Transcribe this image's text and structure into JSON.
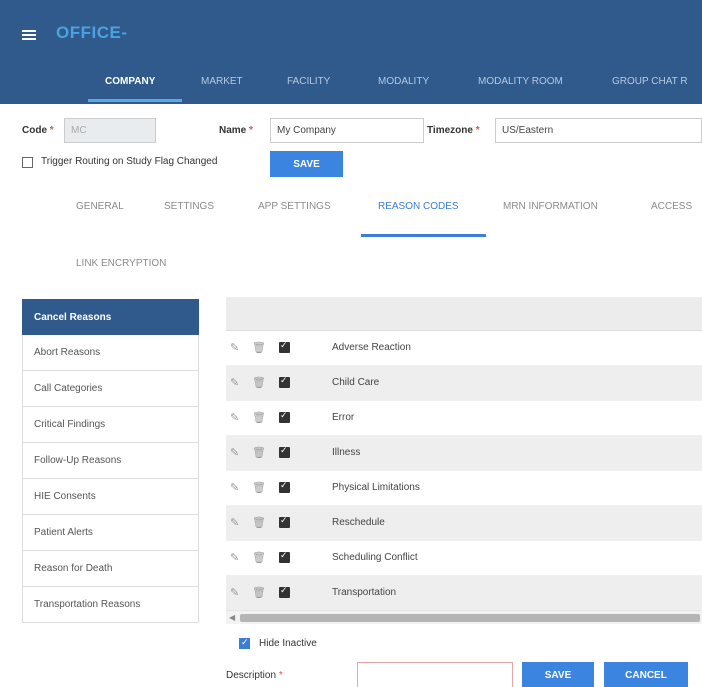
{
  "app": {
    "title": "OFFICE-"
  },
  "nav": {
    "tabs": [
      "COMPANY",
      "MARKET",
      "FACILITY",
      "MODALITY",
      "MODALITY ROOM",
      "GROUP CHAT R"
    ]
  },
  "form": {
    "code_label": "Code",
    "code_value": "MC",
    "name_label": "Name",
    "name_value": "My Company",
    "timezone_label": "Timezone",
    "timezone_value": "US/Eastern",
    "required_mark": "*",
    "trigger_label": "Trigger Routing on Study Flag Changed",
    "trigger_checked": false,
    "save_label": "SAVE"
  },
  "subtabs": [
    "GENERAL",
    "SETTINGS",
    "APP SETTINGS",
    "REASON CODES",
    "MRN INFORMATION",
    "ACCESS",
    "LINK ENCRYPTION"
  ],
  "categories": [
    "Cancel Reasons",
    "Abort Reasons",
    "Call Categories",
    "Critical Findings",
    "Follow-Up Reasons",
    "HIE Consents",
    "Patient Alerts",
    "Reason for Death",
    "Transportation Reasons"
  ],
  "reasons": [
    "Adverse Reaction",
    "Child Care",
    "Error",
    "Illness",
    "Physical Limitations",
    "Reschedule",
    "Scheduling Conflict",
    "Transportation"
  ],
  "footer": {
    "hide_inactive_label": "Hide Inactive",
    "hide_inactive_checked": true,
    "description_label": "Description",
    "description_value": "",
    "save_label": "SAVE",
    "cancel_label": "CANCEL"
  },
  "icons": {
    "menu": "hamburger-icon",
    "edit": "pencil-icon",
    "delete": "trash-icon",
    "active": "checkbox-checked-icon"
  },
  "colors": {
    "header": "#2f5a8b",
    "accent": "#3b85e0",
    "active_tab": "#3b7dd8",
    "required": "#d9534f"
  }
}
